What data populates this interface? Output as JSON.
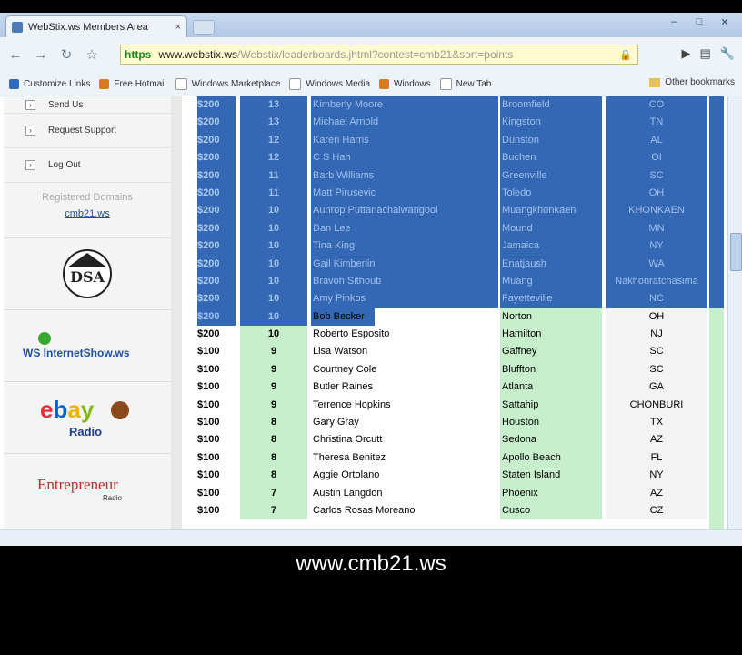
{
  "window": {
    "tab_title": "WebStix.ws Members Area",
    "tab_close": "×",
    "controls": [
      "–",
      "□",
      "✕"
    ]
  },
  "toolbar": {
    "back": "←",
    "forward": "→",
    "reload": "↻",
    "star": "☆",
    "url_scheme": "https",
    "url_host": "www.webstix.ws",
    "url_rest": "/Webstix/leaderboards.jhtml?contest=cmb21&sort=points",
    "right_icons": [
      "▶",
      "▤",
      "🔧"
    ]
  },
  "bookmarks": {
    "items": [
      "Customize Links",
      "Free Hotmail",
      "Windows Marketplace",
      "Windows Media",
      "Windows",
      "New Tab"
    ],
    "other": "Other bookmarks"
  },
  "sidebar": {
    "items": [
      "Send Us",
      "Request Support",
      "Log Out"
    ],
    "registered_domains_label": "Registered Domains",
    "registered_domain": "cmb21.ws",
    "logos": [
      "DSA",
      "WS InternetShow.ws",
      "eBay Radio",
      "Entrepreneur Radio"
    ]
  },
  "table": {
    "rows": [
      {
        "prize": "$200",
        "points": "13",
        "name": "Kimberly Moore",
        "city": "Broomfield",
        "state": "CO",
        "sel": true
      },
      {
        "prize": "$200",
        "points": "13",
        "name": "Michael Arnold",
        "city": "Kingston",
        "state": "TN",
        "sel": true
      },
      {
        "prize": "$200",
        "points": "12",
        "name": "Karen Harris",
        "city": "Dunston",
        "state": "AL",
        "sel": true
      },
      {
        "prize": "$200",
        "points": "12",
        "name": "C S Hah",
        "city": "Buchen",
        "state": "OI",
        "sel": true
      },
      {
        "prize": "$200",
        "points": "11",
        "name": "Barb Williams",
        "city": "Greenville",
        "state": "SC",
        "sel": true
      },
      {
        "prize": "$200",
        "points": "11",
        "name": "Matt Pirusevic",
        "city": "Toledo",
        "state": "OH",
        "sel": true
      },
      {
        "prize": "$200",
        "points": "10",
        "name": "Aunrop Puttanachaiwangool",
        "city": "Muangkhonkaen",
        "state": "KHONKAEN",
        "sel": true
      },
      {
        "prize": "$200",
        "points": "10",
        "name": "Dan Lee",
        "city": "Mound",
        "state": "MN",
        "sel": true
      },
      {
        "prize": "$200",
        "points": "10",
        "name": "Tina King",
        "city": "Jamaica",
        "state": "NY",
        "sel": true
      },
      {
        "prize": "$200",
        "points": "10",
        "name": "Gail Kimberlin",
        "city": "Enatjaush",
        "state": "WA",
        "sel": true
      },
      {
        "prize": "$200",
        "points": "10",
        "name": "Bravoh Sithoub",
        "city": "Muang",
        "state": "Nakhonratchasima",
        "sel": true
      },
      {
        "prize": "$200",
        "points": "10",
        "name": "Amy Pinkos",
        "city": "Fayetteville",
        "state": "NC",
        "sel": true
      },
      {
        "prize": "$200",
        "points": "10",
        "name": "Bob Becker",
        "city": "Norton",
        "state": "OH",
        "sel": "partial"
      },
      {
        "prize": "$200",
        "points": "10",
        "name": "Roberto Esposito",
        "city": "Hamilton",
        "state": "NJ",
        "sel": false
      },
      {
        "prize": "$100",
        "points": "9",
        "name": "Lisa Watson",
        "city": "Gaffney",
        "state": "SC",
        "sel": false
      },
      {
        "prize": "$100",
        "points": "9",
        "name": "Courtney Cole",
        "city": "Bluffton",
        "state": "SC",
        "sel": false
      },
      {
        "prize": "$100",
        "points": "9",
        "name": "Butler Raines",
        "city": "Atlanta",
        "state": "GA",
        "sel": false
      },
      {
        "prize": "$100",
        "points": "9",
        "name": "Terrence Hopkins",
        "city": "Sattahip",
        "state": "CHONBURI",
        "sel": false
      },
      {
        "prize": "$100",
        "points": "8",
        "name": "Gary Gray",
        "city": "Houston",
        "state": "TX",
        "sel": false
      },
      {
        "prize": "$100",
        "points": "8",
        "name": "Christina Orcutt",
        "city": "Sedona",
        "state": "AZ",
        "sel": false
      },
      {
        "prize": "$100",
        "points": "8",
        "name": "Theresa Benitez",
        "city": "Apollo Beach",
        "state": "FL",
        "sel": false
      },
      {
        "prize": "$100",
        "points": "8",
        "name": "Aggie Ortolano",
        "city": "Staten Island",
        "state": "NY",
        "sel": false
      },
      {
        "prize": "$100",
        "points": "7",
        "name": "Austin Langdon",
        "city": "Phoenix",
        "state": "AZ",
        "sel": false
      },
      {
        "prize": "$100",
        "points": "7",
        "name": "Carlos Rosas Moreano",
        "city": "Cusco",
        "state": "CZ",
        "sel": false
      }
    ]
  },
  "caption": "www.cmb21.ws",
  "colors": {
    "selection": "#3467b4",
    "green_cell": "#c7efcb",
    "link": "#1a4e9b"
  }
}
